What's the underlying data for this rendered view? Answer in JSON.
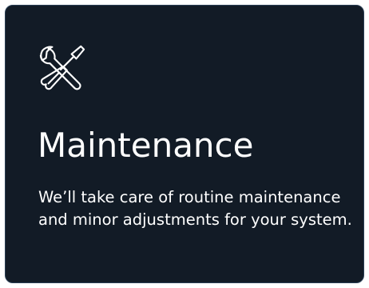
{
  "card": {
    "icon": "wrench-screwdriver-icon",
    "title": "Maintenance",
    "description": "We’ll take care of routine maintenance and minor adjustments for your system."
  },
  "colors": {
    "card_background": "#121b26",
    "card_border": "#2a3f55",
    "text": "#ffffff"
  }
}
